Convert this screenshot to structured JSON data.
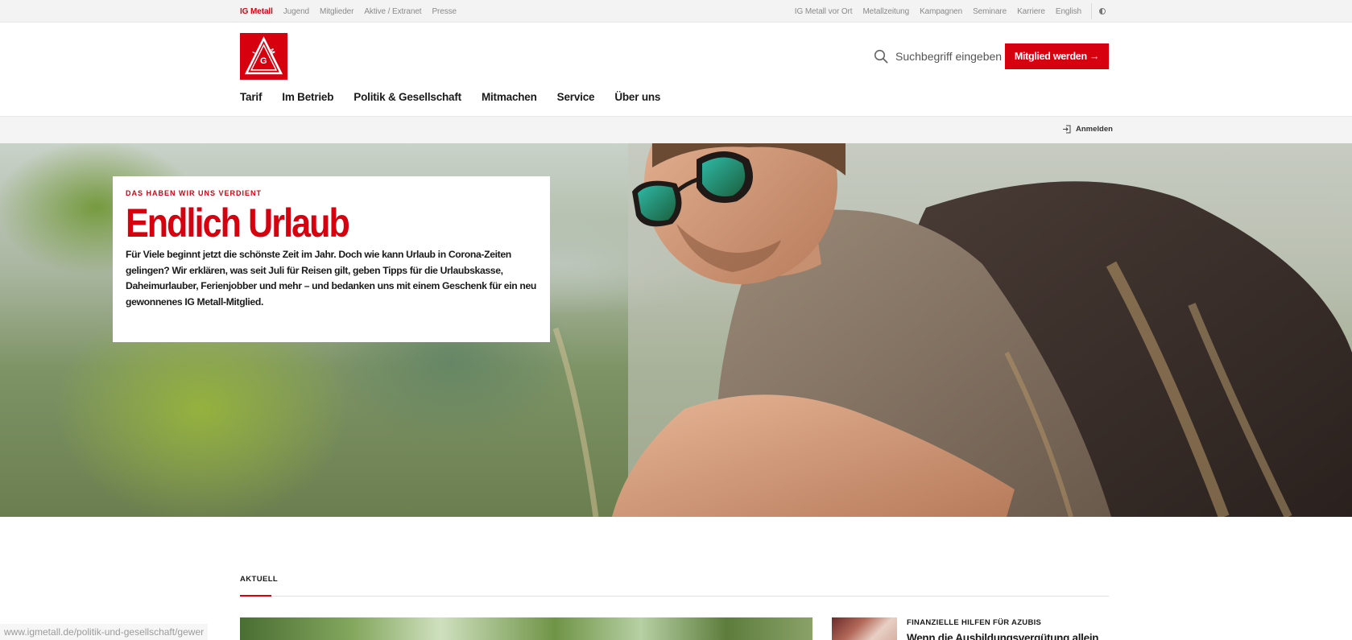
{
  "topbar": {
    "left_links": [
      "IG Metall",
      "Jugend",
      "Mitglieder",
      "Aktive / Extranet",
      "Presse"
    ],
    "right_links": [
      "IG Metall vor Ort",
      "Metallzeitung",
      "Kampagnen",
      "Seminare",
      "Karriere",
      "English"
    ]
  },
  "header": {
    "logo_text": "IGM",
    "search_placeholder": "Suchbegriff eingeben",
    "cta_label": "Mitglied werden →",
    "nav": [
      "Tarif",
      "Im Betrieb",
      "Politik & Gesellschaft",
      "Mitmachen",
      "Service",
      "Über uns"
    ],
    "login_label": "Anmelden"
  },
  "hero": {
    "kicker": "DAS HABEN WIR UNS VERDIENT",
    "title": "Endlich Urlaub",
    "text": "Für Viele beginnt jetzt die schönste Zeit im Jahr. Doch wie kann Urlaub in Corona-Zeiten gelingen? Wir erklären, was seit Juli für Reisen gilt, geben Tipps für die Urlaubskasse, Daheimurlauber, Ferienjobber und mehr – und bedanken uns mit einem Geschenk für ein neu gewonnenes IG Metall-Mitglied."
  },
  "aktuell": {
    "label": "AKTUELL",
    "side_kicker": "FINANZIELLE HILFEN FÜR AZUBIS",
    "side_title": "Wenn die Ausbildungsvergütung allein"
  },
  "status_url": "www.igmetall.de/politik-und-gesellschaft/gewer",
  "colors": {
    "brand_red": "#d7000f",
    "topbar_bg": "#f3f3f4"
  }
}
